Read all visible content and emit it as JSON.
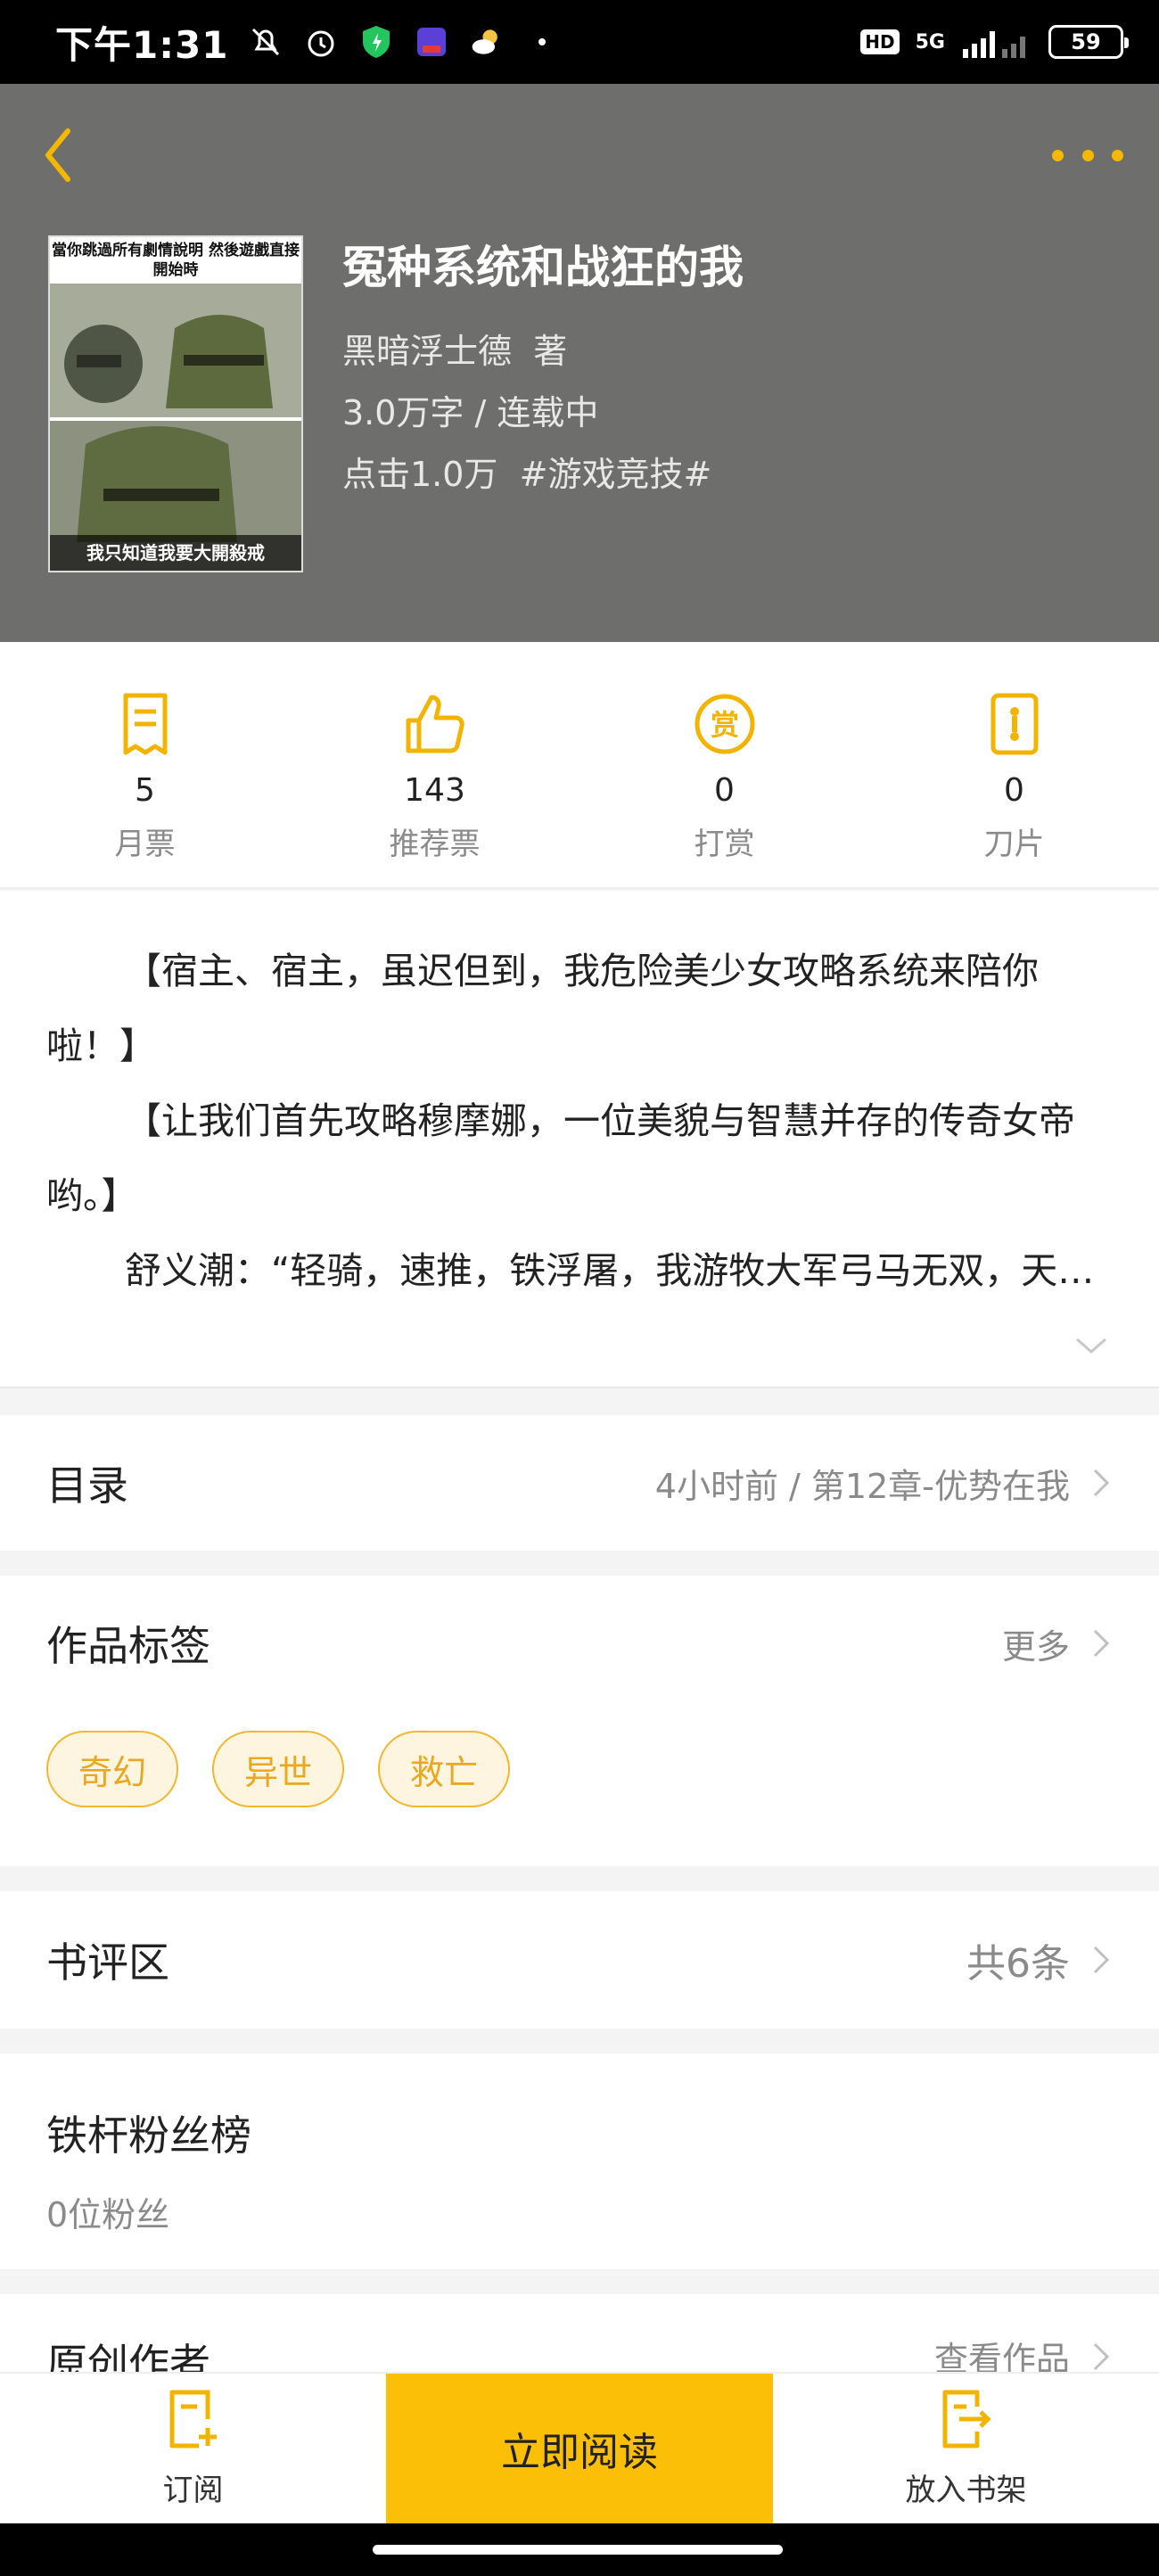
{
  "status_bar": {
    "time": "下午1:31",
    "battery": "59",
    "network": "5G",
    "hd": "HD"
  },
  "book": {
    "title": "冤种系统和战狂的我",
    "author": "黑暗浮士德",
    "author_suffix": "著",
    "word_count": "3.0万字",
    "status": "连载中",
    "clicks": "点击1.0万",
    "genre_tag": "#游戏竞技#",
    "cover_caption_top": "當你跳過所有劇情說明 然後遊戲直接開始時",
    "cover_caption_bottom": "我只知道我要大開殺戒"
  },
  "stats": [
    {
      "value": "5",
      "label": "月票",
      "icon": "ticket-icon"
    },
    {
      "value": "143",
      "label": "推荐票",
      "icon": "thumbs-up-icon"
    },
    {
      "value": "0",
      "label": "打赏",
      "icon": "reward-coin-icon"
    },
    {
      "value": "0",
      "label": "刀片",
      "icon": "blade-icon"
    }
  ],
  "synopsis": {
    "p1": "【宿主、宿主，虽迟但到，我危险美少女攻略系统来陪你啦！】",
    "p2": "【让我们首先攻略穆摩娜，一位美貌与智慧并存的传奇女帝哟。】",
    "p3": "舒义潮：“轻骑，速推，铁浮屠，我游牧大军弓马无双，天…"
  },
  "toc": {
    "title": "目录",
    "latest": "4小时前 / 第12章-优势在我"
  },
  "tags_section": {
    "title": "作品标签",
    "more": "更多",
    "tags": [
      "奇幻",
      "异世",
      "救亡"
    ]
  },
  "review": {
    "title": "书评区",
    "count": "共6条"
  },
  "fans": {
    "title": "铁杆粉丝榜",
    "count": "0位粉丝"
  },
  "author_section": {
    "title": "原创作者",
    "link": "查看作品"
  },
  "bottom_bar": {
    "subscribe": "订阅",
    "read_now": "立即阅读",
    "add_shelf": "放入书架"
  },
  "colors": {
    "accent": "#fcbf08",
    "header_bg": "#6e6f6d",
    "tag_border": "#f2b72c",
    "tag_text": "#e9a81f"
  }
}
